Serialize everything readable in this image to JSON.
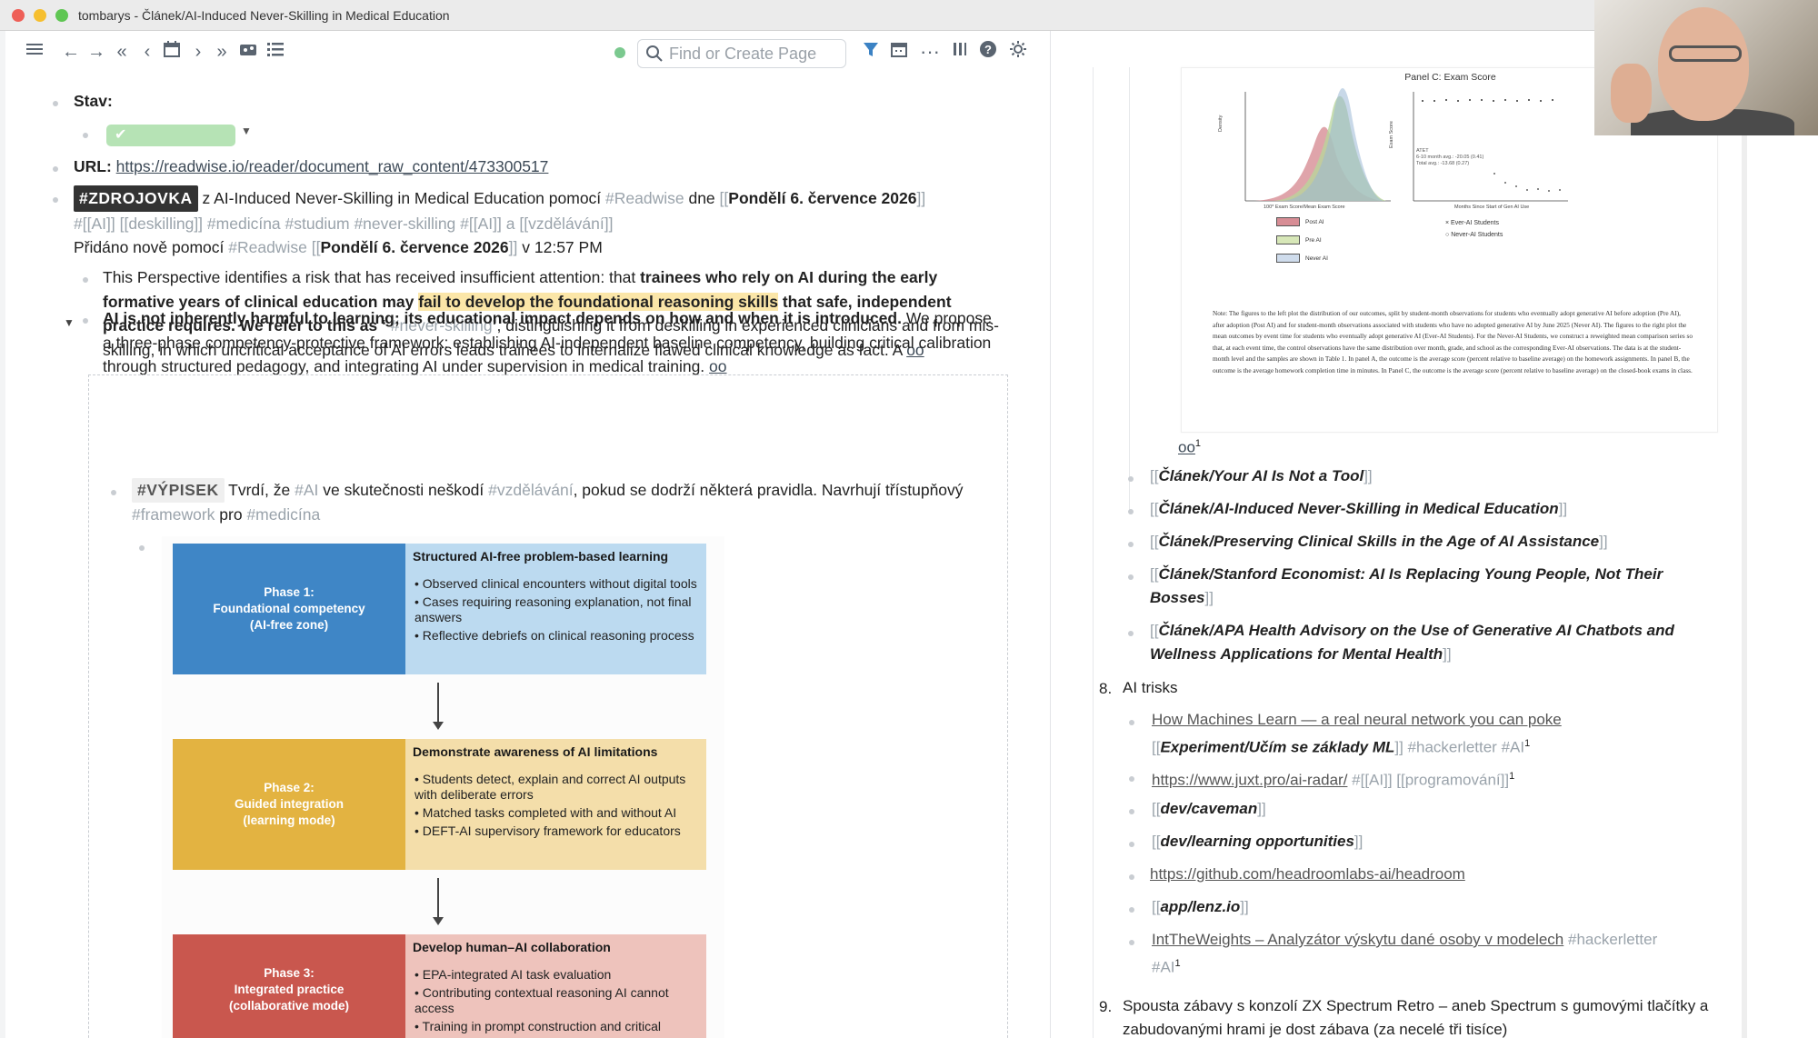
{
  "window": {
    "title": "tombarys - Článek/AI-Induced Never-Skilling in Medical Education"
  },
  "toolbar": {
    "search_placeholder": "Find or Create Page"
  },
  "left": {
    "stav_label": "Stav:",
    "url_label": "URL:",
    "url": "https://readwise.io/reader/document_raw_content/473300517",
    "zdroj": {
      "tag": "#ZDROJOVKA",
      "t1": " z AI-Induced Never-Skilling in Medical Education pomocí ",
      "readwise": "#Readwise",
      "t2": " dne ",
      "date": "Pondělí 6. července 2026",
      "l2_ai": "#[[AI]]",
      "l2_deskilling": "deskilling",
      "l2_medicina": "#medicína",
      "l2_studium": "#studium",
      "l2_never": "#never-skilling",
      "l2_ai2": "#[[AI]]",
      "l2_a": " a ",
      "l2_vzdelavani": "vzdělávání",
      "l3_pridano": "Přidáno nově pomocí ",
      "l3_readwise": "#Readwise",
      "l3_date": "Pondělí 6. července 2026",
      "l3_time": " v 12:57 PM"
    },
    "p1": {
      "a": "This Perspective identifies a risk that has received insufficient attention: that ",
      "b": "trainees who rely on AI during the early formative years of clinical education may ",
      "hl": "fail to develop the foundational reasoning skills",
      "c": " that safe, independent practice requires. We refer to this as ‘",
      "tag": " #never-skilling",
      "d": "’",
      "e": ", distinguishing it from deskilling in experienced clinicians and from mis-skilling, in which uncritical acceptance of AI errors leads trainees to internalize flawed clinical knowledge as fact. A ",
      "oo": "oo"
    },
    "p2": {
      "a": "AI is not inherently harmful to learning; its educational impact depends on how and when it is introduced.",
      "b": " We propose a three-phase competency-protective framework: establishing AI-independent baseline competency, building critical calibration through structured pedagogy, and integrating AI under supervision in medical training. ",
      "oo": "oo"
    },
    "vypisek": {
      "tag": "#VÝPISEK",
      "a": " Tvrdí, že ",
      "ai": "#AI",
      "b": " ve skutečnosti neškodí ",
      "vzd": "#vzdělávání",
      "c": ", pokud se dodrží některá pravidla. Navrhují třístupňový ",
      "fw": "#framework",
      "d": " pro ",
      "med": "#medicína"
    },
    "figure": {
      "phases": [
        {
          "left": "Phase 1:\nFoundational competency\n(AI-free zone)",
          "title": "Structured AI-free problem-based learning",
          "items": [
            "• Observed clinical encounters without digital tools",
            "• Cases requiring reasoning explanation, not final answers",
            "• Reflective debriefs on clinical reasoning process"
          ],
          "color_left": "#3f86c6",
          "color_right": "#bcdaf0"
        },
        {
          "left": "Phase 2:\nGuided integration\n(learning mode)",
          "title": "Demonstrate awareness of AI limitations",
          "items": [
            "• Students detect, explain and correct AI outputs with deliberate errors",
            "• Matched tasks completed with and without AI",
            "• DEFT-AI supervisory framework for educators"
          ],
          "color_left": "#e3b341",
          "color_right": "#f4deaa"
        },
        {
          "left": "Phase 3:\nIntegrated practice\n(collaborative mode)",
          "title": "Develop human–AI collaboration",
          "items": [
            "• EPA-integrated AI task evaluation",
            "• Contributing contextual reasoning AI cannot access",
            "• Training in prompt construction and critical"
          ],
          "color_left": "#c9574e",
          "color_right": "#eec3bc"
        }
      ]
    }
  },
  "right": {
    "paper": {
      "panel_title": "Panel C: Exam Score",
      "y_left": "Density",
      "x_left": "100* Exam Score/Mean Exam Score",
      "y_right": "Exam Score",
      "x_right": "Months Since Start of Gen AI Use",
      "legend_left": [
        "Post AI",
        "Pre AI",
        "Never AI"
      ],
      "legend_right": [
        "Ever-AI Students",
        "Never-AI Students"
      ],
      "stats": [
        "ATET",
        "6-10 month avg.: -20.05 (0.41)",
        "Total avg.: -13.68 (0.27)"
      ],
      "note": "Note: The figures to the left plot the distribution of our outcomes, split by student-month observations for students who eventually adopt generative AI before adoption (Pre AI), after adoption (Post AI) and for student-month observations associated with students who have no adopted generative AI by June 2025 (Never AI). The figures to the right plot the mean outcomes by event time for students who eventually adopt generative AI (Ever-AI Students). For the Never-AI Students, we construct a reweighted mean comparison series so that, at each event time, the control observations have the same distribution over month, grade, and school as the corresponding Ever-AI observations. The data is at the student-month level and the samples are shown in Table 1. In panel A, the outcome is the average score (percent relative to baseline average) on the homework assignments. In panel B, the outcome is the average homework completion time in minutes. In Panel C, the outcome is the average score (percent relative to baseline average) on the closed-book exams in class."
    },
    "oo": "oo",
    "oo_sup": "1",
    "links": [
      "Článek/Your AI Is Not a Tool",
      "Článek/AI-Induced Never-Skilling in Medical Education",
      "Článek/Preserving Clinical Skills in the Age of AI Assistance",
      "Článek/Stanford Economist: AI Is Replacing Young People, Not Their Bosses",
      "Článek/APA Health Advisory on the Use of Generative AI Chatbots and Wellness Applications for Mental Health"
    ],
    "item8_num": "8.",
    "item8": "AI trisks",
    "t1_link": "How Machines Learn — a real neural network you can poke",
    "t1_ref": "Experiment/Učím se základy ML",
    "t1_tags": " #hackerletter #AI",
    "sup1": "1",
    "t2_link": "https://www.juxt.pro/ai-radar/",
    "t2_tag1": " #[[AI]] ",
    "t2_tag2": "[[programování]]",
    "t3": "dev/caveman",
    "t4": "dev/learning opportunities",
    "t5": "https://github.com/headroomlabs-ai/headroom",
    "t6": "app/lenz.io",
    "t7_link": "IntTheWeights – Analyzátor výskytu dané osoby v modelech",
    "t7_tag": " #hackerletter",
    "t7_tag2": "#AI",
    "item9_num": "9.",
    "item9": "Spousta zábavy s konzolí ZX Spectrum Retro – aneb Spectrum s gumovými tlačítky a zabudovanými hrami je dost zábava (za necelé tři tisíce)"
  }
}
